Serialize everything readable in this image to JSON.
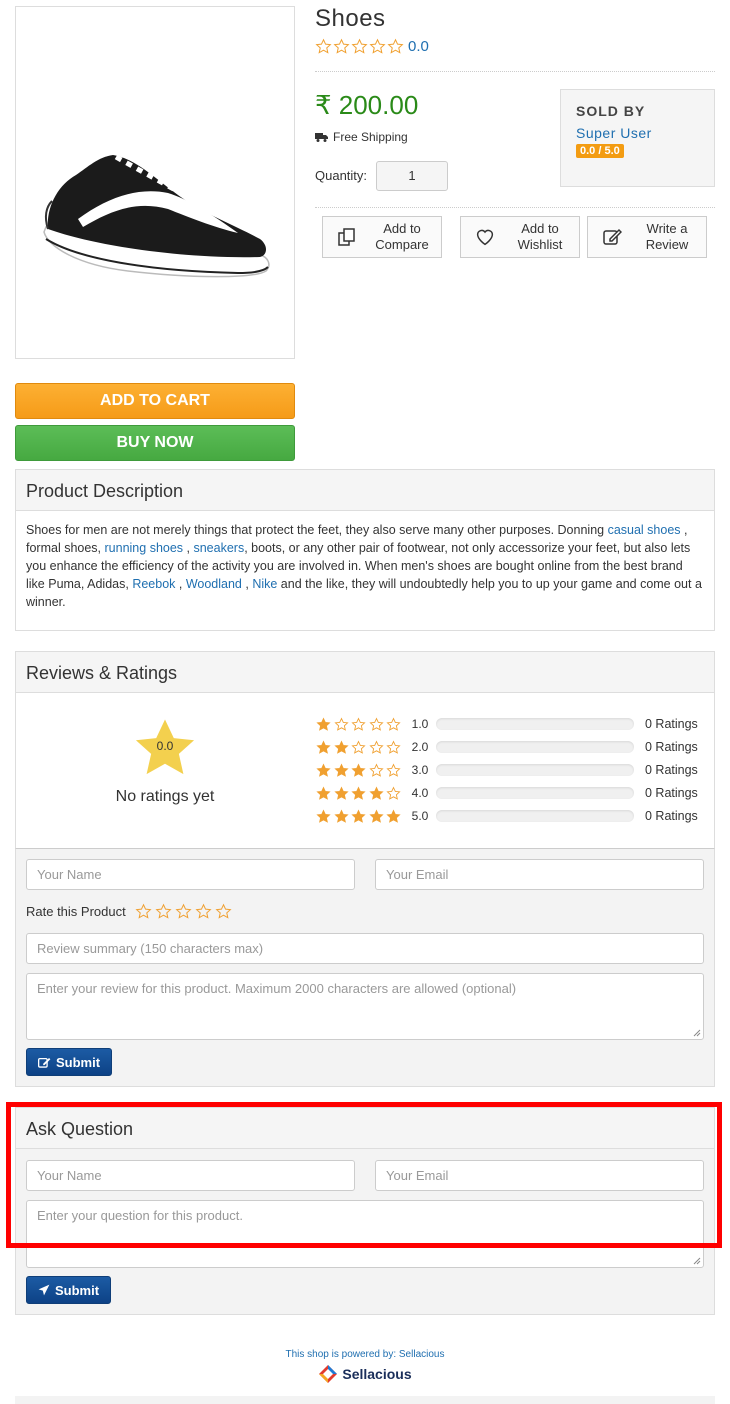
{
  "product": {
    "title": "Shoes",
    "rating_value": "0.0",
    "price": "₹ 200.00",
    "shipping": "Free Shipping",
    "quantity_label": "Quantity:",
    "quantity_value": "1"
  },
  "seller": {
    "label": "SOLD BY",
    "name": "Super User",
    "rating": "0.0 / 5.0"
  },
  "actions": {
    "compare": "Add to Compare",
    "wishlist": "Add to Wishlist",
    "review": "Write a Review"
  },
  "buttons": {
    "add_to_cart": "ADD TO CART",
    "buy_now": "BUY NOW"
  },
  "description": {
    "heading": "Product Description",
    "text_1": "Shoes for men are not merely things that protect the feet, they also serve many other purposes. Donning ",
    "link_1": "casual shoes",
    "text_2": " , formal shoes, ",
    "link_2": "running shoes",
    "text_3": " , ",
    "link_3": "sneakers",
    "text_4": ", boots, or any other pair of footwear, not only accessorize your feet, but also lets you enhance the efficiency of the activity you are involved in. When men's shoes are bought online from the best brand like Puma, Adidas, ",
    "link_4": "Reebok",
    "text_5": " , ",
    "link_5": "Woodland",
    "text_6": " , ",
    "link_6": "Nike",
    "text_7": " and the like, they will undoubtedly help you to up your game and come out a winner."
  },
  "reviews": {
    "heading": "Reviews & Ratings",
    "average": "0.0",
    "no_ratings": "No ratings yet",
    "rows": [
      {
        "stars": 1,
        "value": "1.0",
        "count": "0 Ratings"
      },
      {
        "stars": 2,
        "value": "2.0",
        "count": "0 Ratings"
      },
      {
        "stars": 3,
        "value": "3.0",
        "count": "0 Ratings"
      },
      {
        "stars": 4,
        "value": "4.0",
        "count": "0 Ratings"
      },
      {
        "stars": 5,
        "value": "5.0",
        "count": "0 Ratings"
      }
    ],
    "form": {
      "name_placeholder": "Your Name",
      "email_placeholder": "Your Email",
      "rate_label": "Rate this Product",
      "summary_placeholder": "Review summary (150 characters max)",
      "review_placeholder": "Enter your review for this product. Maximum 2000 characters are allowed (optional)",
      "submit": "Submit"
    }
  },
  "ask": {
    "heading": "Ask Question",
    "name_placeholder": "Your Name",
    "email_placeholder": "Your Email",
    "question_placeholder": "Enter your question for this product.",
    "submit": "Submit"
  },
  "footer": {
    "powered": "This shop is powered by: Sellacious",
    "brand": "Sellacious"
  },
  "colors": {
    "price_green": "#2a8a18",
    "link_blue": "#1f6fb0",
    "star_orange": "#f0a030",
    "highlight_red": "#ff0000"
  }
}
